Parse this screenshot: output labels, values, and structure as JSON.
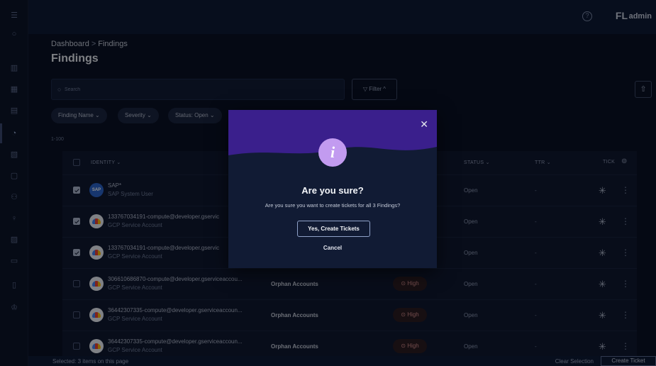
{
  "topbar": {
    "help_icon": "help-circle-icon",
    "avatar_initials": "FL",
    "user": "admin"
  },
  "breadcrumb": {
    "root": "Dashboard",
    "sep": ">",
    "current": "Findings"
  },
  "page_title": "Findings",
  "search": {
    "placeholder": "Search"
  },
  "filter": {
    "label": "Filter ^"
  },
  "chips": [
    "Finding Name ⌄",
    "Severity ⌄",
    "Status: Open ⌄"
  ],
  "count": "1-100",
  "columns": {
    "identity": "IDENTITY ⌄",
    "status": "STATUS ⌄",
    "ttr": "TTR ⌄",
    "tick": "TICK"
  },
  "rows": [
    {
      "checked": true,
      "avatar": "sap",
      "avatar_text": "SAP",
      "name": "SAP*",
      "type": "SAP System User",
      "finding": "",
      "severity": "",
      "status": "Open",
      "ttr": "-"
    },
    {
      "checked": true,
      "avatar": "gcp",
      "avatar_text": "",
      "name": "133767034191-compute@developer.gservic",
      "type": "GCP Service Account",
      "finding": "",
      "severity": "",
      "status": "Open",
      "ttr": "-"
    },
    {
      "checked": true,
      "avatar": "gcp",
      "avatar_text": "",
      "name": "133767034191-compute@developer.gservic",
      "type": "GCP Service Account",
      "finding": "",
      "severity": "",
      "status": "Open",
      "ttr": "-"
    },
    {
      "checked": false,
      "avatar": "gcp",
      "avatar_text": "",
      "name": "306610686870-compute@developer.gserviceaccou...",
      "type": "GCP Service Account",
      "finding": "Orphan Accounts",
      "severity": "High",
      "status": "Open",
      "ttr": "-"
    },
    {
      "checked": false,
      "avatar": "gcp",
      "avatar_text": "",
      "name": "36442307335-compute@developer.gserviceaccoun...",
      "type": "GCP Service Account",
      "finding": "Orphan Accounts",
      "severity": "High",
      "status": "Open",
      "ttr": "-"
    },
    {
      "checked": false,
      "avatar": "gcp",
      "avatar_text": "",
      "name": "36442307335-compute@developer.gserviceaccoun...",
      "type": "GCP Service Account",
      "finding": "Orphan Accounts",
      "severity": "High",
      "status": "Open",
      "ttr": "-"
    }
  ],
  "bottombar": {
    "selected": "Selected: 3 items on this page",
    "clear": "Clear Selection",
    "create": "Create Ticket"
  },
  "modal": {
    "title": "Are you sure?",
    "message": "Are you sure you want to create tickets for all 3 Findings?",
    "confirm": "Yes, Create Tickets",
    "cancel": "Cancel",
    "band_color": "#3a1f8c",
    "icon_color": "#c29bf0"
  },
  "colors": {
    "background": "#060d1f",
    "topbar": "#0d1a36",
    "severity_high": "#d48c8c"
  }
}
